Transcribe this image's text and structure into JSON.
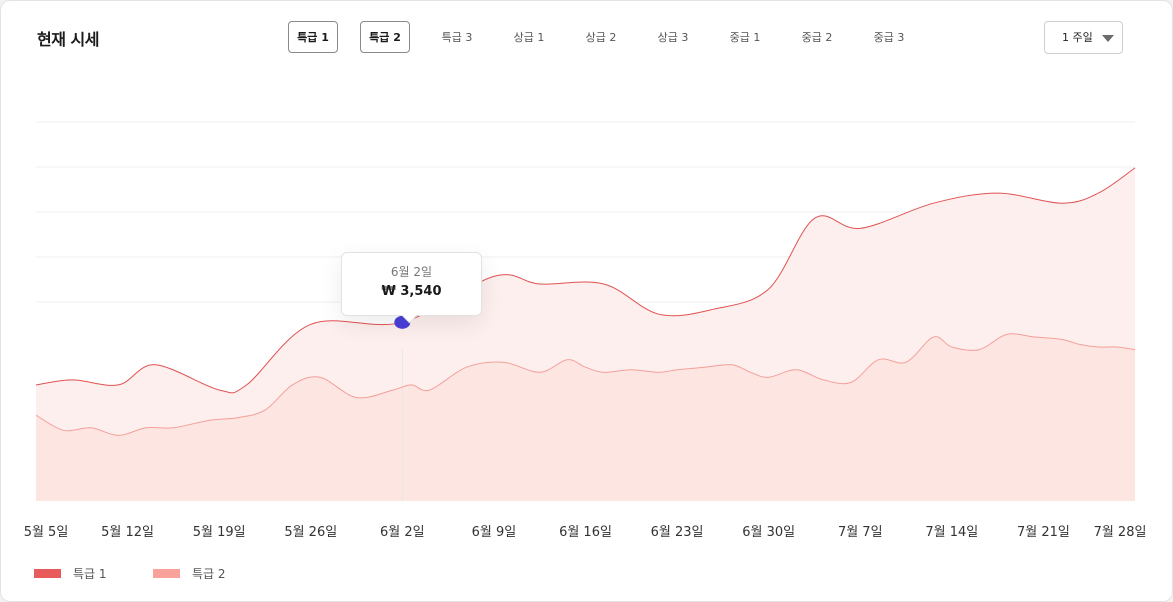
{
  "header": {
    "title": "현재 시세",
    "tabs": [
      "특급 1",
      "특급 2",
      "특급 3",
      "상급 1",
      "상급 2",
      "상급 3",
      "중급 1",
      "중급 2",
      "중급 3"
    ],
    "active_tabs": [
      0,
      1
    ],
    "period_label": "1 주일"
  },
  "tooltip": {
    "date": "6월 2일",
    "price": "₩ 3,540"
  },
  "colors": {
    "series1_line": "#e05252",
    "series1_fill": "#fdecea",
    "series2_line": "#f3a09a",
    "series2_fill": "#fde3e0",
    "marker": "#4a3fd9",
    "swatch1": "#e95b5b",
    "swatch2": "#f9a29b"
  },
  "chart_data": {
    "type": "area",
    "categories": [
      "5월 5일",
      "5월 12일",
      "5월 19일",
      "5월 26일",
      "6월 2일",
      "6월 9일",
      "6월 16일",
      "6월 23일",
      "6월 30일",
      "7월 7일",
      "7월 14일",
      "7월 21일",
      "7월 28일"
    ],
    "ylim": [
      0,
      8400
    ],
    "grid": true,
    "legend_position": "bottom-left",
    "highlight": {
      "series": 0,
      "category_index": 4
    },
    "series": [
      {
        "name": "특급 1",
        "x": [
          0,
          0.4,
          0.9,
          1.3,
          2.0,
          2.3,
          3.0,
          4.0,
          5.0,
          5.5,
          6.2,
          6.8,
          7.4,
          8.0,
          8.5,
          9.0,
          9.8,
          10.5,
          11.2,
          11.6,
          12.0
        ],
        "values": [
          2300,
          2400,
          2300,
          2700,
          2200,
          2300,
          3500,
          3540,
          4450,
          4300,
          4300,
          3700,
          3800,
          4200,
          5600,
          5400,
          5900,
          6100,
          5900,
          6100,
          6600
        ]
      },
      {
        "name": "특급 2",
        "x": [
          0,
          0.3,
          0.6,
          0.9,
          1.2,
          1.5,
          1.9,
          2.2,
          2.5,
          2.8,
          3.1,
          3.5,
          3.9,
          4.1,
          4.3,
          4.7,
          5.1,
          5.5,
          5.8,
          6.0,
          6.2,
          6.5,
          6.8,
          7.0,
          7.3,
          7.6,
          7.8,
          8.0,
          8.3,
          8.6,
          8.9,
          9.2,
          9.5,
          9.8,
          10.0,
          10.3,
          10.6,
          10.9,
          11.2,
          11.4,
          11.6,
          11.8,
          12.0
        ],
        "values": [
          1700,
          1400,
          1450,
          1300,
          1450,
          1450,
          1600,
          1650,
          1800,
          2300,
          2450,
          2050,
          2200,
          2300,
          2200,
          2650,
          2750,
          2550,
          2800,
          2650,
          2550,
          2600,
          2550,
          2600,
          2650,
          2700,
          2550,
          2450,
          2600,
          2400,
          2350,
          2800,
          2750,
          3250,
          3050,
          3000,
          3300,
          3250,
          3200,
          3100,
          3050,
          3050,
          3000
        ]
      }
    ]
  },
  "legend": [
    {
      "label": "특급 1"
    },
    {
      "label": "특급 2"
    }
  ]
}
